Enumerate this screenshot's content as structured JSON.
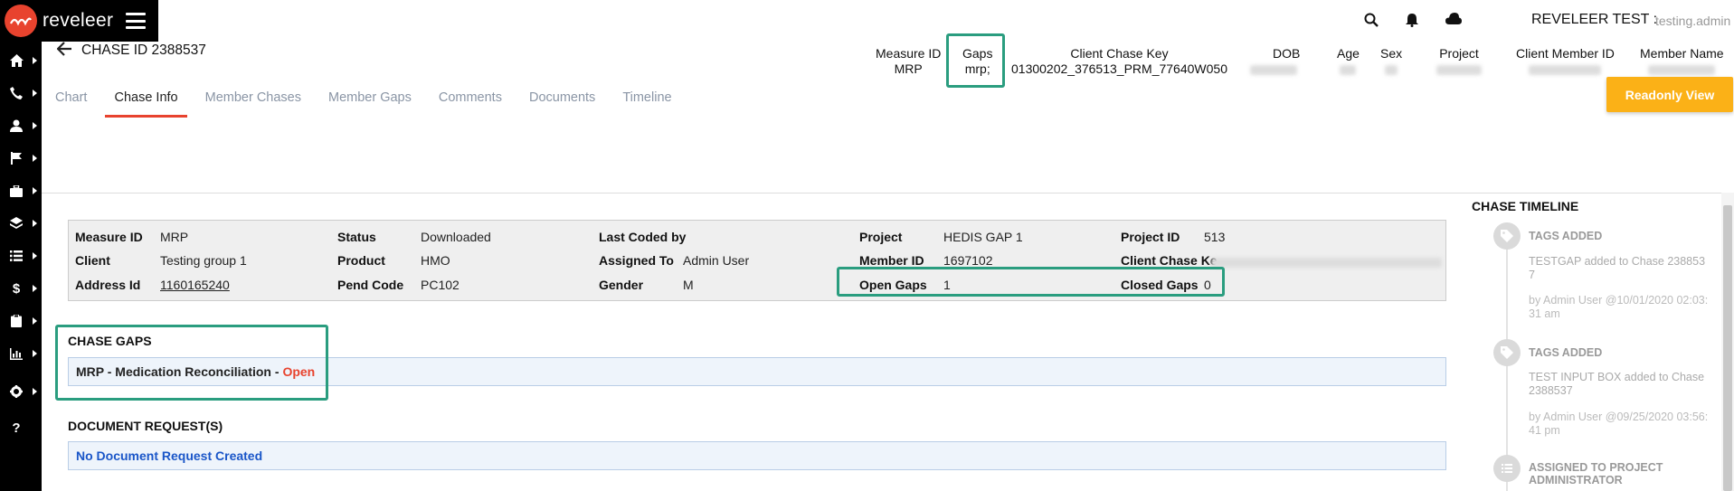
{
  "app": {
    "logo_text": "reveleer",
    "user_name": "REVELEER TEST :",
    "user_login": "testing.admin"
  },
  "rail": {
    "icons": [
      "home-icon",
      "phone-icon",
      "user-icon",
      "flag-icon",
      "briefcase-icon",
      "layers-icon",
      "list-icon",
      "dollar-icon",
      "clipboard-icon",
      "chart-icon",
      "gear-icon",
      "help-icon"
    ]
  },
  "header": {
    "chase_title": "CHASE ID 2388537",
    "measure_id_label": "Measure ID",
    "measure_id_value": "MRP",
    "gaps_label": "Gaps",
    "gaps_value": "mrp;",
    "client_chase_key_label": "Client Chase Key",
    "client_chase_key_value": "01300202_376513_PRM_77640W050",
    "dob_label": "DOB",
    "age_label": "Age",
    "sex_label": "Sex",
    "project_label": "Project",
    "client_member_id_label": "Client Member ID",
    "member_name_label": "Member Name"
  },
  "tabs": [
    "Chart",
    "Chase Info",
    "Member Chases",
    "Member Gaps",
    "Comments",
    "Documents",
    "Timeline"
  ],
  "active_tab": "Chase Info",
  "readonly_button": "Readonly View",
  "info": {
    "measure_id_label": "Measure ID",
    "measure_id": "MRP",
    "status_label": "Status",
    "status": "Downloaded",
    "last_coded_label": "Last Coded by",
    "project_label": "Project",
    "project": "HEDIS GAP 1",
    "project_id_label": "Project ID",
    "project_id": "513",
    "client_label": "Client",
    "client": "Testing group 1",
    "product_label": "Product",
    "product": "HMO",
    "assigned_label": "Assigned To",
    "assigned": "Admin User",
    "member_id_label": "Member ID",
    "member_id": "1697102",
    "client_chase_key_label": "Client Chase Ke",
    "address_label": "Address Id",
    "address": "1160165240",
    "pend_label": "Pend Code",
    "pend": "PC102",
    "gender_label": "Gender",
    "gender": "M",
    "open_gaps_label": "Open Gaps",
    "open_gaps": "1",
    "closed_gaps_label": "Closed Gaps",
    "closed_gaps": "0"
  },
  "chase_gaps": {
    "title": "CHASE GAPS",
    "gap_text": "MRP - Medication Reconciliation - ",
    "gap_status": "Open"
  },
  "doc_request": {
    "title": "DOCUMENT REQUEST(S)",
    "text": "No Document Request Created"
  },
  "timeline": {
    "title": "CHASE TIMELINE",
    "items": [
      {
        "head": "TAGS ADDED",
        "body": "TESTGAP added to Chase 2388537",
        "by": "by Admin User @10/01/2020 02:03:31 am"
      },
      {
        "head": "TAGS ADDED",
        "body": "TEST INPUT BOX added to Chase 2388537",
        "by": "by Admin User @09/25/2020 03:56:41 pm"
      },
      {
        "head": "ASSIGNED TO PROJECT ADMINISTRATOR",
        "body": "",
        "by": ""
      }
    ]
  },
  "colors": {
    "accent": "#e8432e",
    "button": "#fbb117",
    "highlight": "#2a9d7f",
    "link": "#1a56c8"
  }
}
